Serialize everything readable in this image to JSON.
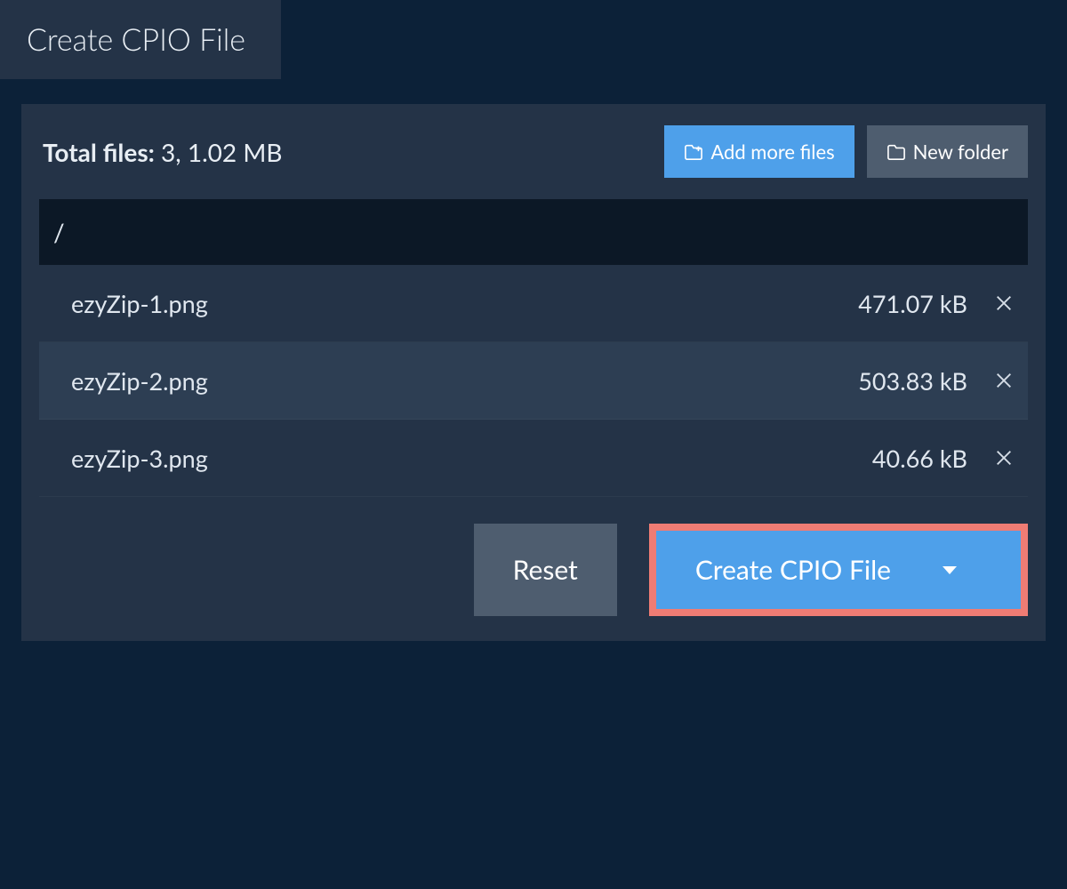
{
  "tab": {
    "label": "Create CPIO File"
  },
  "summary": {
    "label": "Total files:",
    "count": "3",
    "size": "1.02 MB"
  },
  "buttons": {
    "add_more": "Add more files",
    "new_folder": "New folder",
    "reset": "Reset",
    "create": "Create CPIO File"
  },
  "path": "/",
  "files": [
    {
      "name": "ezyZip-1.png",
      "size": "471.07 kB"
    },
    {
      "name": "ezyZip-2.png",
      "size": "503.83 kB"
    },
    {
      "name": "ezyZip-3.png",
      "size": "40.66 kB"
    }
  ]
}
